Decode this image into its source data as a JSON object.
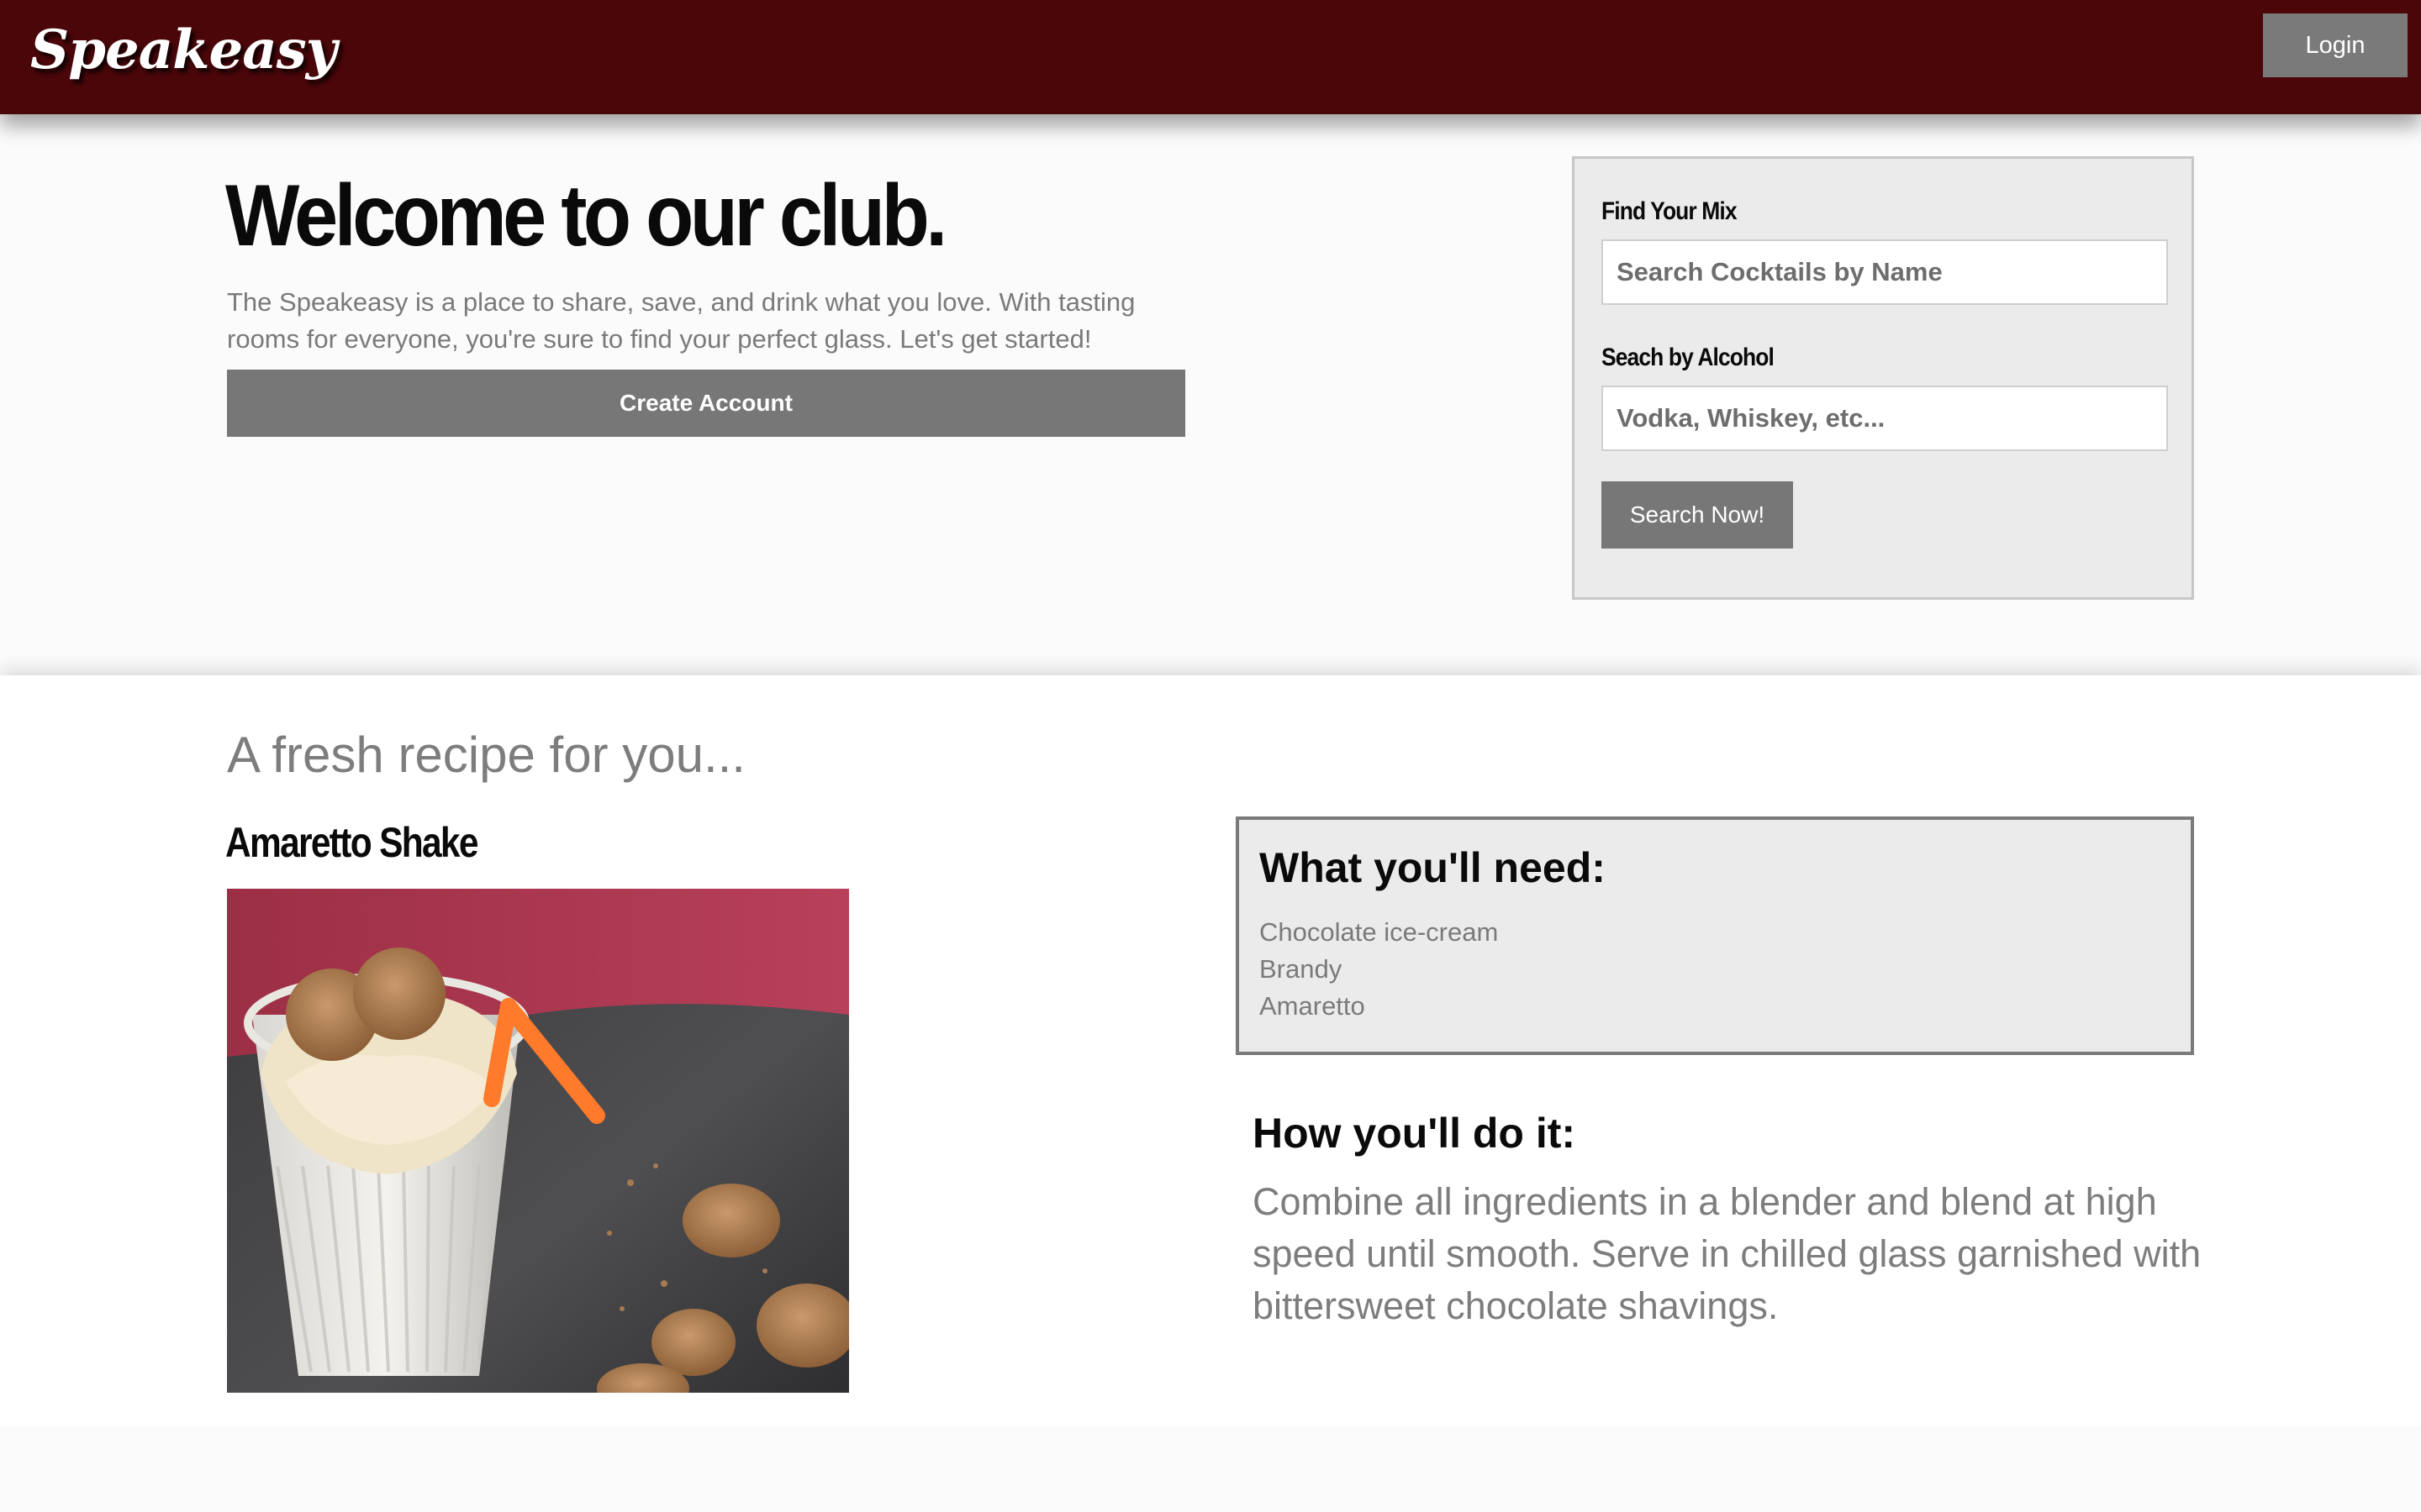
{
  "header": {
    "brand": "Speakeasy",
    "login_label": "Login",
    "bar_color": "#4a0609"
  },
  "hero": {
    "title": "Welcome to our club.",
    "description": "The Speakeasy is a place to share, save, and drink what you love. With tasting rooms for everyone, you're sure to find your perfect glass. Let's get started!",
    "create_account_label": "Create Account"
  },
  "search": {
    "mix_label": "Find Your Mix",
    "mix_placeholder": "Search Cocktails by Name",
    "alcohol_label": "Seach by Alcohol",
    "alcohol_placeholder": "Vodka, Whiskey, etc...",
    "submit_label": "Search Now!"
  },
  "recipe": {
    "section_heading": "A fresh recipe for you...",
    "name": "Amaretto Shake",
    "ingredients_title": "What you'll need:",
    "ingredients": [
      "Chocolate ice-cream",
      "Brandy",
      "Amaretto"
    ],
    "howto_title": "How you'll do it:",
    "howto_text": "Combine all ingredients in a blender and blend at high speed until smooth. Serve in chilled glass garnished with bittersweet chocolate shavings."
  }
}
